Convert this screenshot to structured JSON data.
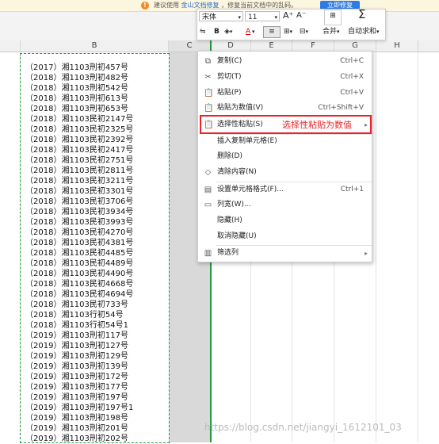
{
  "notice": {
    "text_prefix": "建议使用",
    "link": "金山文档修复",
    "text_suffix": "，修复当前文档中的乱码。",
    "button": "立即修复"
  },
  "minibar": {
    "font_name": "宋体",
    "font_size": "11",
    "grow_font": "A⁺",
    "shrink_font": "A⁻",
    "bold": "B",
    "font_color": "A",
    "merge_label": "合并",
    "autosum_label": "自动求和",
    "sigma": "Σ"
  },
  "columns": [
    "B",
    "C",
    "D",
    "E",
    "F",
    "G",
    "H"
  ],
  "cells": [
    "（2017）湘1103刑初457号",
    "（2018）湘1103刑初482号",
    "（2018）湘1103刑初542号",
    "（2018）湘1103刑初613号",
    "（2018）湘1103刑初653号",
    "（2018）湘1103民初2147号",
    "（2018）湘1103民初2325号",
    "（2018）湘1103民初2392号",
    "（2018）湘1103民初2417号",
    "（2018）湘1103民初2751号",
    "（2018）湘1103民初2811号",
    "（2018）湘1103民初3211号",
    "（2018）湘1103民初3301号",
    "（2018）湘1103民初3706号",
    "（2018）湘1103民初3934号",
    "（2018）湘1103民初3993号",
    "（2018）湘1103民初4270号",
    "（2018）湘1103民初4381号",
    "（2018）湘1103民初4485号",
    "（2018）湘1103民初4489号",
    "（2018）湘1103民初4490号",
    "（2018）湘1103民初4668号",
    "（2018）湘1103民初4694号",
    "（2018）湘1103民初733号",
    "（2018）湘1103行初54号",
    "（2018）湘1103行初54号1",
    "（2019）湘1103刑初117号",
    "（2019）湘1103刑初127号",
    "（2019）湘1103刑初129号",
    "（2019）湘1103刑初139号",
    "（2019）湘1103刑初172号",
    "（2019）湘1103刑初177号",
    "（2019）湘1103刑初197号",
    "（2019）湘1103刑初197号1",
    "（2019）湘1103刑初198号",
    "（2019）湘1103刑初201号",
    "（2019）湘1103刑初202号"
  ],
  "menu": [
    {
      "icon": "copy-icon",
      "glyph": "⧉",
      "label": "复制(C)",
      "shortcut": "Ctrl+C"
    },
    {
      "icon": "cut-icon",
      "glyph": "✂",
      "label": "剪切(T)",
      "shortcut": "Ctrl+X"
    },
    {
      "icon": "paste-icon",
      "glyph": "📋",
      "label": "粘贴(P)",
      "shortcut": "Ctrl+V"
    },
    {
      "icon": "paste-values-icon",
      "glyph": "📋",
      "label": "粘贴为数值(V)",
      "shortcut": "Ctrl+Shift+V"
    },
    {
      "icon": "paste-special-icon",
      "glyph": "📋",
      "label": "选择性粘贴(S)",
      "shortcut": ""
    },
    {
      "icon": "",
      "glyph": "",
      "label": "插入复制单元格(E)",
      "shortcut": ""
    },
    {
      "icon": "",
      "glyph": "",
      "label": "删除(D)",
      "shortcut": ""
    },
    {
      "icon": "clear-icon",
      "glyph": "◇",
      "label": "清除内容(N)",
      "shortcut": ""
    },
    {
      "icon": "format-cells-icon",
      "glyph": "▤",
      "label": "设置单元格格式(F)...",
      "shortcut": "Ctrl+1"
    },
    {
      "icon": "column-width-icon",
      "glyph": "▭",
      "label": "列宽(W)...",
      "shortcut": ""
    },
    {
      "icon": "",
      "glyph": "",
      "label": "隐藏(H)",
      "shortcut": ""
    },
    {
      "icon": "",
      "glyph": "",
      "label": "取消隐藏(U)",
      "shortcut": ""
    },
    {
      "icon": "filter-icon",
      "glyph": "▥",
      "label": "筛选列",
      "shortcut": ""
    }
  ],
  "annotation": "选择性粘贴为数值",
  "watermark": "https://blog.csdn.net/jiangyi_1612101_03"
}
